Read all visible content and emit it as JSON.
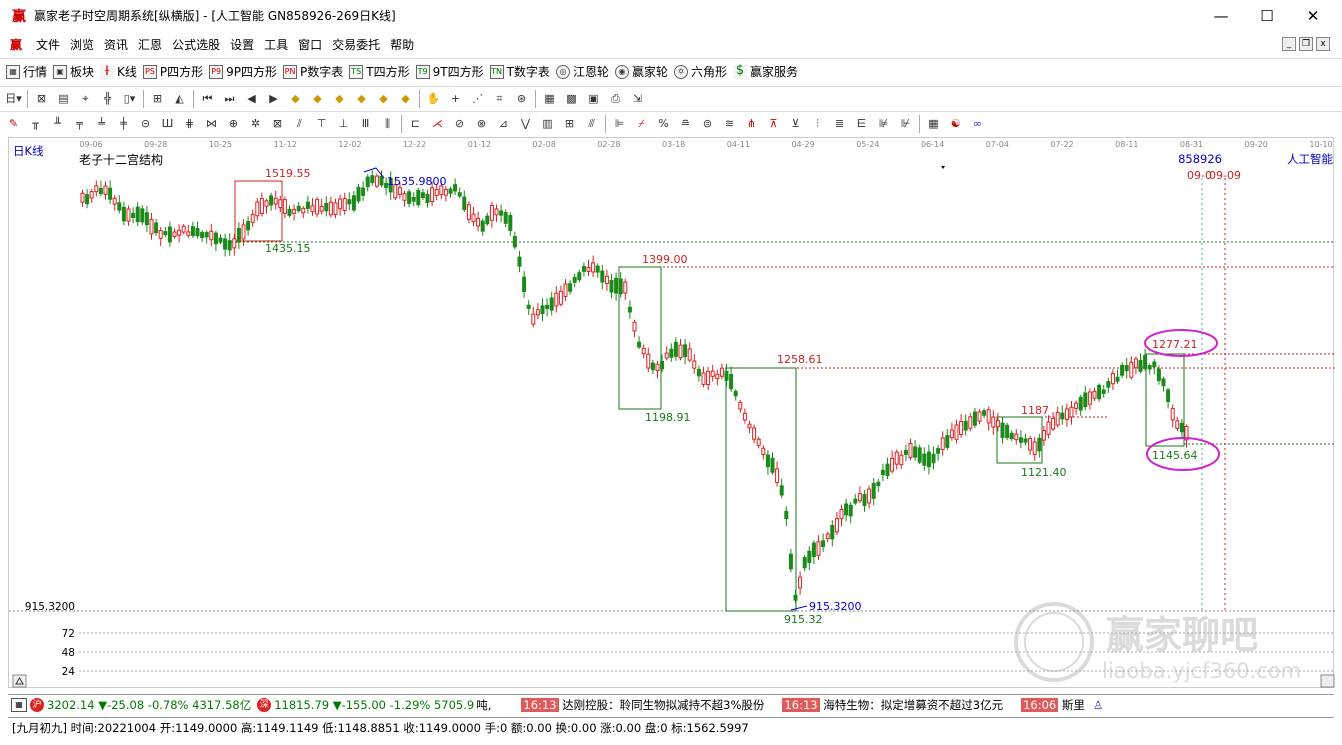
{
  "window": {
    "title": "赢家老子时空周期系统[纵横版] - [人工智能  GN858926-269日K线]",
    "minimize": "—",
    "maximize": "☐",
    "close": "✕"
  },
  "menu": [
    "文件",
    "浏览",
    "资讯",
    "汇恩",
    "公式选股",
    "设置",
    "工具",
    "窗口",
    "交易委托",
    "帮助"
  ],
  "toolbar1": [
    {
      "label": "行情",
      "icon": "grid-icon"
    },
    {
      "label": "板块",
      "icon": "blocks-icon"
    },
    {
      "label": "K线",
      "icon": "kline-icon"
    },
    {
      "label": "P四方形",
      "icon": "p-square-icon"
    },
    {
      "label": "9P四方形",
      "icon": "9p-square-icon"
    },
    {
      "label": "P数字表",
      "icon": "p-number-icon"
    },
    {
      "label": "T四方形",
      "icon": "t-square-icon"
    },
    {
      "label": "9T四方形",
      "icon": "9t-square-icon"
    },
    {
      "label": "T数字表",
      "icon": "t-number-icon"
    },
    {
      "label": "江恩轮",
      "icon": "gann-wheel-icon"
    },
    {
      "label": "赢家轮",
      "icon": "winner-wheel-icon"
    },
    {
      "label": "六角形",
      "icon": "hexagon-icon"
    },
    {
      "label": "赢家服务",
      "icon": "dollar-icon"
    }
  ],
  "chart": {
    "period_label": "日K线",
    "indicator_name": "老子十二宫结构",
    "code": "858926",
    "name": "人工智能",
    "date_ticks": [
      "09-06",
      "09-28",
      "10-25",
      "11-12",
      "12-02",
      "12-22",
      "01-12",
      "02-08",
      "02-28",
      "03-18",
      "04-11",
      "04-29",
      "05-24",
      "06-14",
      "07-04",
      "07-22",
      "08-11",
      "08-31",
      "09-20",
      "10-10"
    ],
    "low_readout": "915.3200",
    "bottom_ticks": [
      "72",
      "48",
      "24"
    ],
    "annotations": {
      "a1519": "1519.55",
      "a1435": "1435.15",
      "a1535": "1535.9800",
      "a1399": "1399.00",
      "a1198": "1198.91",
      "a1258": "1258.61",
      "a1187": "1187",
      "a1121": "1121.40",
      "a1277": "1277.21",
      "a1145": "1145.64",
      "a915a": "915.3200",
      "a915b": "915.32",
      "d1": "09-0",
      "d2": "09-09"
    }
  },
  "chart_data": {
    "type": "candlestick",
    "title": "老子十二宫结构",
    "x_ticks": [
      "09-06",
      "09-28",
      "10-25",
      "11-12",
      "12-02",
      "12-22",
      "01-12",
      "02-08",
      "02-28",
      "03-18",
      "04-11",
      "04-29",
      "05-24",
      "06-14",
      "07-04",
      "07-22",
      "08-11",
      "08-31",
      "09-20",
      "10-10"
    ],
    "levels": [
      1535.98,
      1519.55,
      1435.15,
      1399.0,
      1277.21,
      1258.61,
      1198.91,
      1187,
      1145.64,
      1121.4,
      915.32
    ],
    "ylim": [
      900,
      1560
    ]
  },
  "status1": {
    "idx1": "3202.14",
    "idx1_chg": "▼-25.08",
    "idx1_pct": "-0.78%",
    "idx1_amt": "4317.58亿",
    "idx2": "11815.79",
    "idx2_chg": "▼-155.00",
    "idx2_pct": "-1.29%",
    "idx2_amt": "5705.9",
    "news_prefix": "吨,",
    "news": [
      {
        "time": "16:13",
        "text": "达刚控股：聆同生物拟减持不超3%股份"
      },
      {
        "time": "16:13",
        "text": "海特生物：拟定增募资不超过3亿元"
      },
      {
        "time": "16:06",
        "text": "斯里"
      }
    ]
  },
  "status2": "[九月初九] 时间:20221004 开:1149.0000 高:1149.1149 低:1148.8851 收:1149.0000 手:0 额:0.00 换:0.00 涨:0.00 盘:0 标:1562.5997",
  "watermark": {
    "brand": "赢家聊吧",
    "url": "liaoba.yjcf360.com"
  }
}
